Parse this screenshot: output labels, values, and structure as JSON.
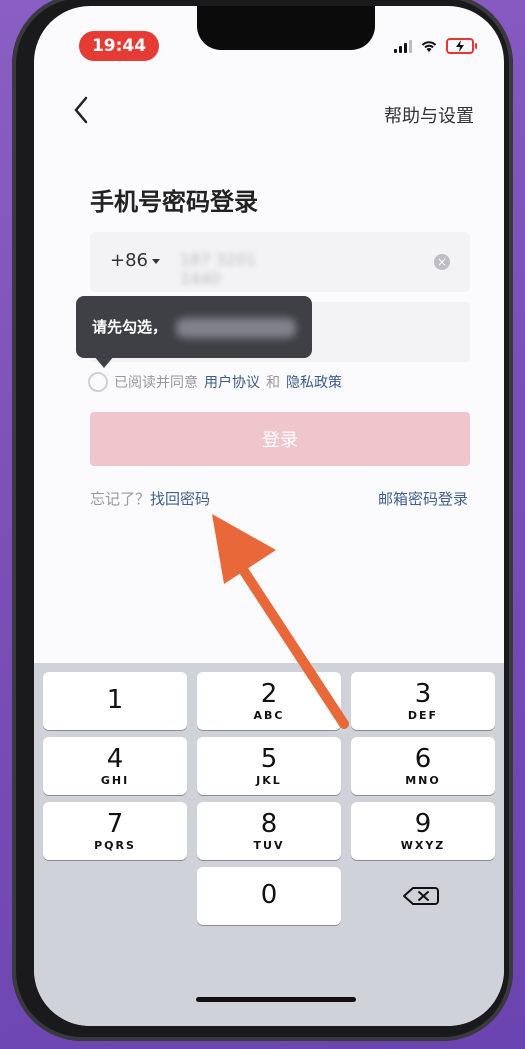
{
  "status_bar": {
    "time": "19:44"
  },
  "nav": {
    "help_settings": "帮助与设置"
  },
  "page": {
    "title": "手机号密码登录"
  },
  "phone_input": {
    "country_code": "+86",
    "value_blurred": "187 3201 1440"
  },
  "tooltip": {
    "text": "请先勾选，"
  },
  "agreement": {
    "prefix": "已阅读并同意",
    "user_agreement": "用户协议",
    "and": "和",
    "privacy_policy": "隐私政策"
  },
  "login_button": {
    "label": "登录"
  },
  "forgot": {
    "prefix": "忘记了？",
    "recover_link": "找回密码"
  },
  "email_login": {
    "label": "邮箱密码登录"
  },
  "keypad": {
    "keys": [
      {
        "num": "1",
        "letters": ""
      },
      {
        "num": "2",
        "letters": "ABC"
      },
      {
        "num": "3",
        "letters": "DEF"
      },
      {
        "num": "4",
        "letters": "GHI"
      },
      {
        "num": "5",
        "letters": "JKL"
      },
      {
        "num": "6",
        "letters": "MNO"
      },
      {
        "num": "7",
        "letters": "PQRS"
      },
      {
        "num": "8",
        "letters": "TUV"
      },
      {
        "num": "9",
        "letters": "WXYZ"
      },
      {
        "num": "0",
        "letters": ""
      }
    ]
  },
  "colors": {
    "accent_pink": "#f1c5cc",
    "link_blue": "#3f5f8e",
    "arrow": "#e8683a",
    "time_pill": "#e63b35"
  }
}
